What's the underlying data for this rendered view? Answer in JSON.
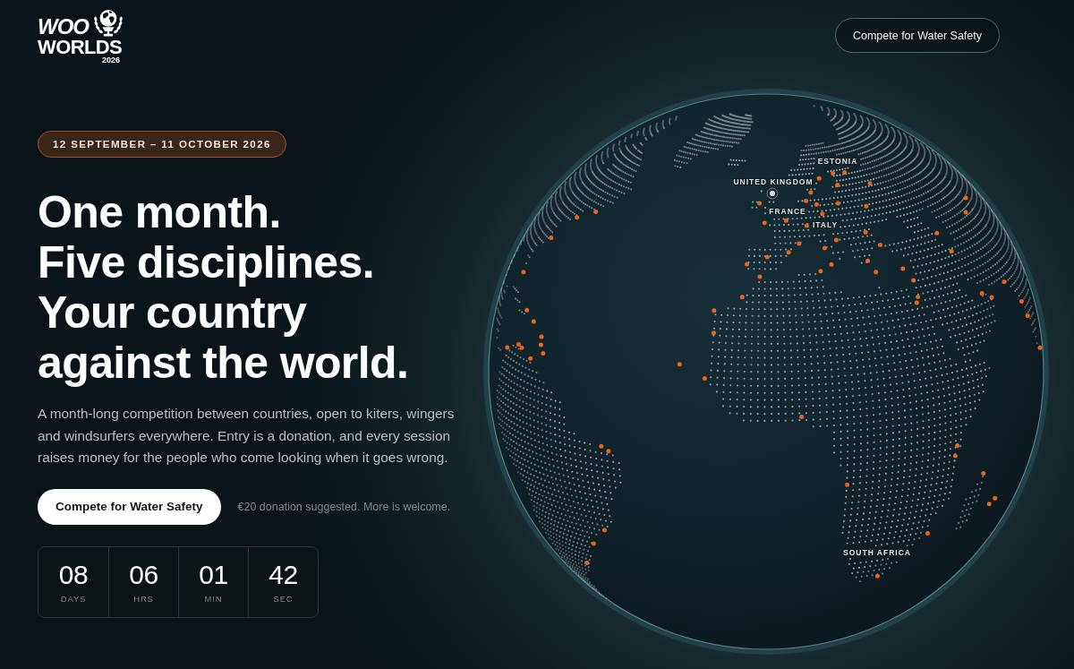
{
  "header": {
    "logo": {
      "wordmark": "WOO",
      "title": "WORLDS",
      "year": "2026"
    },
    "button": "Compete for Water Safety"
  },
  "hero": {
    "dates": "12 SEPTEMBER – 11 OCTOBER 2026",
    "headline": [
      "One month.",
      "Five disciplines.",
      "Your country",
      "against the world."
    ],
    "description": "A month-long competition between countries, open to kiters, wingers and windsurfers everywhere. Entry is a donation, and every session raises money for the people who come looking when it goes wrong.",
    "cta": "Compete for Water Safety",
    "cta_note": "€20 donation suggested. More is welcome.",
    "countdown": [
      {
        "value": "08",
        "unit": "DAYS"
      },
      {
        "value": "06",
        "unit": "HRS"
      },
      {
        "value": "01",
        "unit": "MIN"
      },
      {
        "value": "42",
        "unit": "SEC"
      }
    ]
  },
  "globe": {
    "labels": [
      {
        "label": "ESTONIA",
        "selected": false
      },
      {
        "label": "UNITED KINGDOM",
        "selected": true
      },
      {
        "label": "FRANCE",
        "selected": false
      },
      {
        "label": "ITALY",
        "selected": false
      },
      {
        "label": "SOUTH AFRICA",
        "selected": false
      }
    ]
  }
}
